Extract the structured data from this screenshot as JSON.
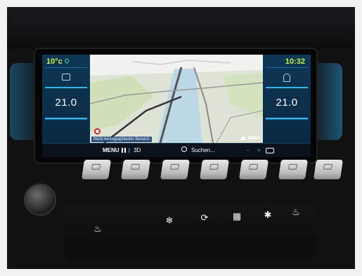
{
  "climate": {
    "outside_temp": "10°c",
    "left_temp": "21.0",
    "right_temp": "21.0",
    "clock": "10:32"
  },
  "map": {
    "caption": "Nicht kartographierter Bereich",
    "distance": "485m"
  },
  "navbar": {
    "menu_label": "MENU",
    "mode_label": "3D",
    "search_label": "Suchen...",
    "zoom_out_label": "−",
    "zoom_in_label": "+"
  },
  "hardware_buttons": {
    "glyphs": [
      "♨",
      "❄",
      "⟳",
      "▦",
      "✱",
      "♨"
    ]
  },
  "icons": {
    "outside_temp": "drop-icon",
    "flag": "flag-icon",
    "search": "search-icon",
    "layers": "layers-icon",
    "warning": "warning-icon"
  },
  "colors": {
    "accent_blue": "#37b6ee",
    "temp_green": "#c7ef4f",
    "panel_bg": "#0e3756"
  }
}
